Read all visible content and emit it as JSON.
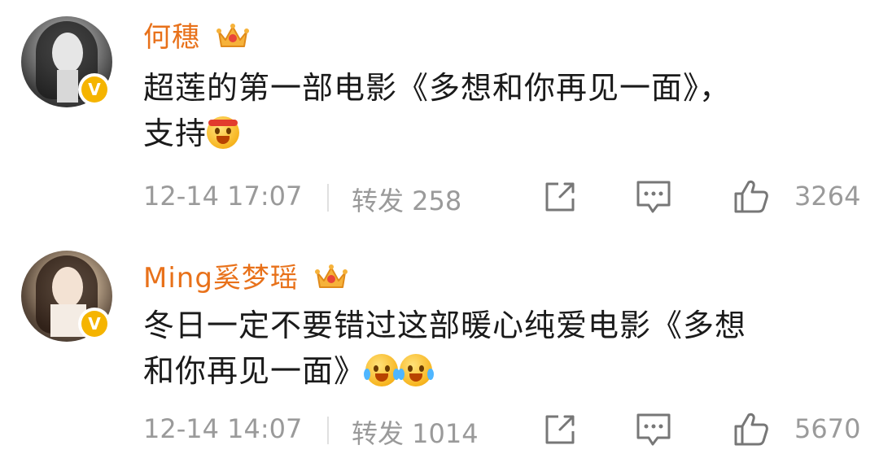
{
  "posts": [
    {
      "username": "何穗",
      "text_line1": "超莲的第一部电影《多想和你再见一面》，",
      "text_line2": "支持",
      "time": "12-14 17:07",
      "repost_label": "转发 258",
      "likes": "3264",
      "icons": [
        "crown-icon",
        "verified-v-icon",
        "share-icon",
        "comment-icon",
        "like-icon"
      ],
      "emoji": [
        "cheer-emoji"
      ]
    },
    {
      "username": "Ming奚梦瑶",
      "text_line1": "冬日一定不要错过这部暖心纯爱电影《多想",
      "text_line2": "和你再见一面》",
      "time": "12-14 14:07",
      "repost_label": "转发 1014",
      "likes": "5670",
      "icons": [
        "crown-icon",
        "verified-v-icon",
        "share-icon",
        "comment-icon",
        "like-icon"
      ],
      "emoji": [
        "laugh-cry-emoji",
        "laugh-cry-emoji"
      ]
    }
  ],
  "colors": {
    "username": "#e8711a",
    "body_text": "#1a1a1a",
    "meta_text": "#9a9a9a",
    "verified_badge": "#f5b400"
  },
  "badge_letter": "V"
}
